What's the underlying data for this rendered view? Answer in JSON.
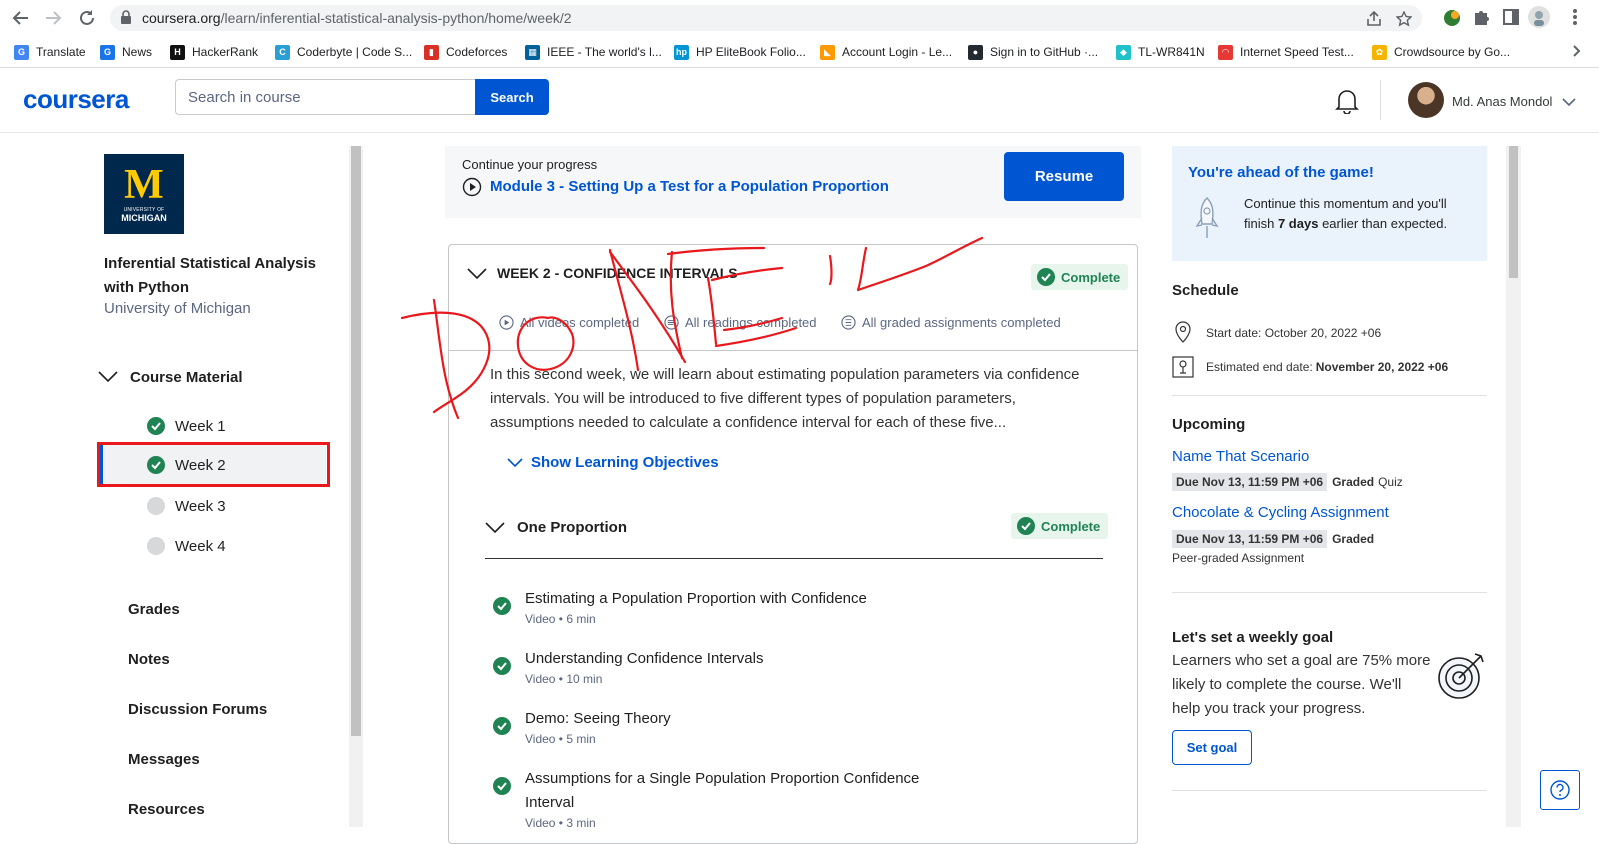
{
  "browser": {
    "url_host": "coursera.org",
    "url_path": "/learn/inferential-statistical-analysis-python/home/week/2",
    "bookmarks": [
      {
        "label": "Translate",
        "color": "#4285f4",
        "glyph": "G"
      },
      {
        "label": "News",
        "color": "#1a73e8",
        "glyph": "G"
      },
      {
        "label": "HackerRank",
        "color": "#111111",
        "glyph": "H"
      },
      {
        "label": "Coderbyte | Code S...",
        "color": "#2a9fd6",
        "glyph": "C"
      },
      {
        "label": "Codeforces",
        "color": "#d93025",
        "glyph": "▮"
      },
      {
        "label": "IEEE - The world's l...",
        "color": "#00629b",
        "glyph": "▦"
      },
      {
        "label": "HP EliteBook Folio...",
        "color": "#0096d6",
        "glyph": "hp"
      },
      {
        "label": "Account Login - Le...",
        "color": "#ff9900",
        "glyph": "◣"
      },
      {
        "label": "Sign in to GitHub ·...",
        "color": "#24292f",
        "glyph": "●"
      },
      {
        "label": "TL-WR841N",
        "color": "#20c1c9",
        "glyph": "◆"
      },
      {
        "label": "Internet Speed Test...",
        "color": "#e53935",
        "glyph": "◠"
      },
      {
        "label": "Crowdsource by Go...",
        "color": "#f4b400",
        "glyph": "✿"
      }
    ]
  },
  "header": {
    "logo": "coursera",
    "search_placeholder": "Search in course",
    "search_button": "Search",
    "user_name": "Md. Anas Mondol"
  },
  "sidebar": {
    "university_logo_m": "M",
    "university_logo_line1": "UNIVERSITY OF",
    "university_logo_line2": "MICHIGAN",
    "course_title": "Inferential Statistical Analysis with Python",
    "course_org": "University of Michigan",
    "course_material": "Course Material",
    "weeks": [
      {
        "label": "Week 1",
        "status": "complete"
      },
      {
        "label": "Week 2",
        "status": "complete"
      },
      {
        "label": "Week 3",
        "status": "incomplete"
      },
      {
        "label": "Week 4",
        "status": "incomplete"
      }
    ],
    "links": [
      "Grades",
      "Notes",
      "Discussion Forums",
      "Messages",
      "Resources"
    ]
  },
  "progress": {
    "label": "Continue your progress",
    "module": "Module 3 - Setting Up a Test for a Population Proportion",
    "resume": "Resume"
  },
  "week": {
    "title": "WEEK 2 - CONFIDENCE INTERVALS",
    "status": "Complete",
    "stats": [
      "All videos completed",
      "All readings completed",
      "All graded assignments completed"
    ],
    "description": "In this second week, we will learn about estimating population parameters via confidence intervals. You will be introduced to five different types of population parameters, assumptions needed to calculate a confidence interval for each of these five...",
    "show_objectives": "Show Learning Objectives",
    "lesson": {
      "title": "One Proportion",
      "status": "Complete",
      "items": [
        {
          "title": "Estimating a Population Proportion with Confidence",
          "meta": "Video • 6 min"
        },
        {
          "title": "Understanding Confidence Intervals",
          "meta": "Video • 10 min"
        },
        {
          "title": "Demo: Seeing Theory",
          "meta": "Video • 5 min"
        },
        {
          "title": "Assumptions for a Single Population Proportion Confidence Interval",
          "meta": "Video • 3 min"
        }
      ]
    }
  },
  "right": {
    "ahead_title": "You're ahead of the game!",
    "ahead_text_1": "Continue this momentum and you'll finish ",
    "ahead_bold": "7 days",
    "ahead_text_2": " earlier than expected.",
    "schedule_title": "Schedule",
    "start_date": "Start date: October 20, 2022 +06",
    "end_label": "Estimated end date: ",
    "end_date": "November 20, 2022 +06",
    "upcoming_title": "Upcoming",
    "upcoming": [
      {
        "title": "Name That Scenario",
        "due": "Due Nov 13, 11:59 PM +06",
        "graded": "Graded",
        "kind": "Quiz"
      },
      {
        "title": "Chocolate & Cycling Assignment",
        "due": "Due Nov 13, 11:59 PM +06",
        "graded": "Graded",
        "kind": "Peer-graded Assignment"
      }
    ],
    "goal_title": "Let's set a weekly goal",
    "goal_text": "Learners who set a goal are 75% more likely to complete the course. We'll help you track your progress.",
    "set_goal": "Set goal"
  },
  "annotation": {
    "handwritten_text": "DONE",
    "color": "#e8181d"
  },
  "colors": {
    "brand": "#0056d2",
    "complete_green": "#1f8354"
  }
}
